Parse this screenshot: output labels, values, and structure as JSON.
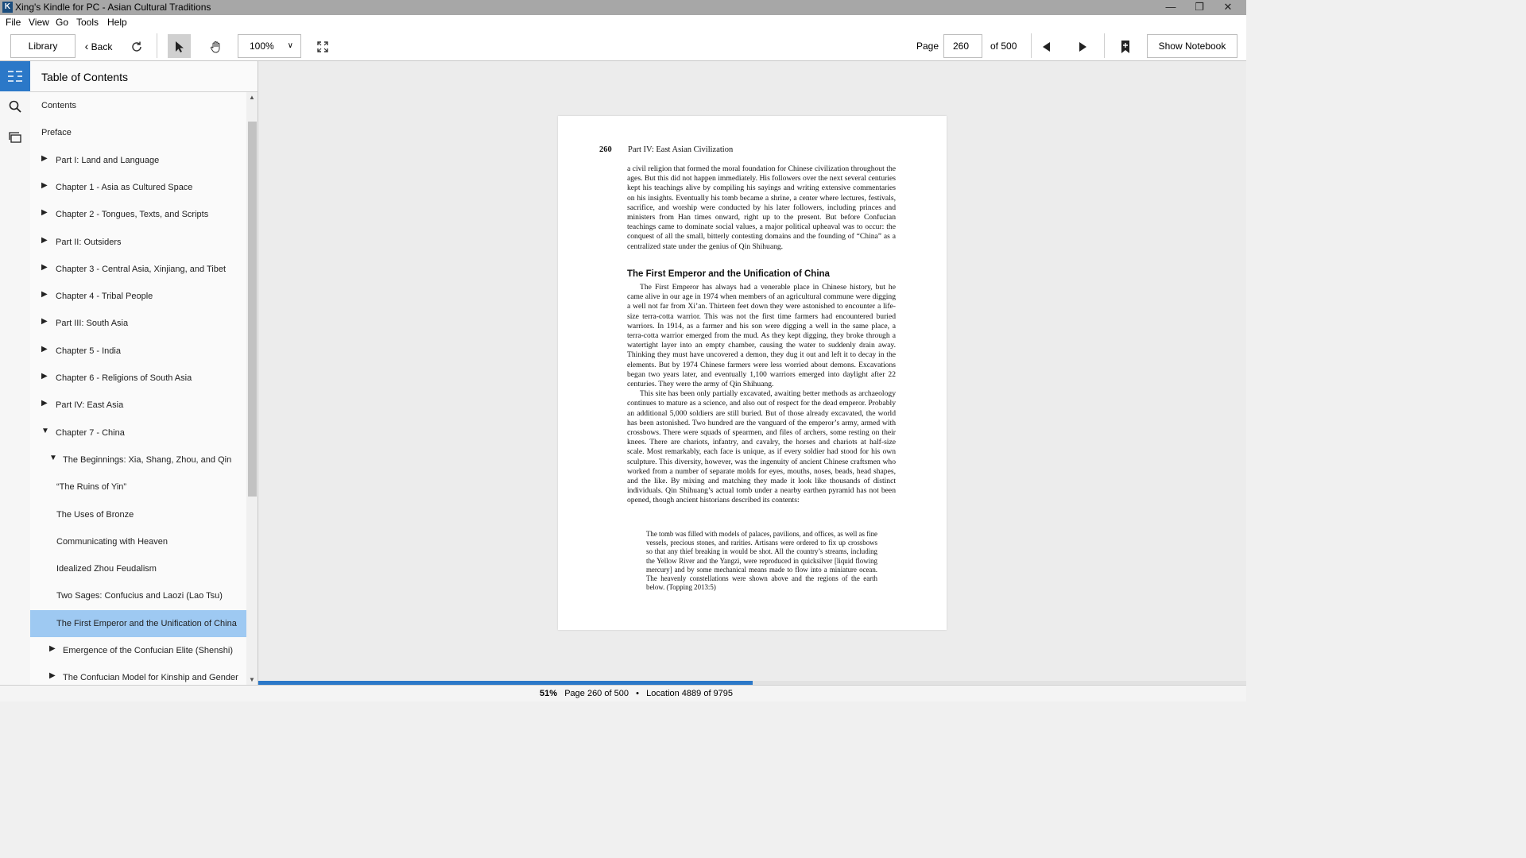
{
  "window": {
    "title": "Xing's Kindle for PC - Asian Cultural Traditions",
    "controls": [
      "minimize",
      "maximize",
      "close"
    ]
  },
  "menu": [
    "File",
    "View",
    "Go",
    "Tools",
    "Help"
  ],
  "toolbar": {
    "library_label": "Library",
    "back_label": "Back",
    "zoom_value": "100%",
    "page_label": "Page",
    "page_value": "260",
    "page_total": "of 500",
    "show_notebook_label": "Show Notebook"
  },
  "toc": {
    "title": "Table of Contents",
    "items": [
      {
        "label": "Contents",
        "level": 0,
        "arrow": "none"
      },
      {
        "label": "Preface",
        "level": 0,
        "arrow": "none"
      },
      {
        "label": "Part I: Land and Language",
        "level": 0,
        "arrow": "collapsed"
      },
      {
        "label": "Chapter 1 - Asia as Cultured Space",
        "level": 0,
        "arrow": "collapsed"
      },
      {
        "label": "Chapter 2 - Tongues, Texts, and Scripts",
        "level": 0,
        "arrow": "collapsed"
      },
      {
        "label": "Part II: Outsiders",
        "level": 0,
        "arrow": "collapsed"
      },
      {
        "label": "Chapter 3 - Central Asia, Xinjiang, and Tibet",
        "level": 0,
        "arrow": "collapsed"
      },
      {
        "label": "Chapter 4 - Tribal People",
        "level": 0,
        "arrow": "collapsed"
      },
      {
        "label": "Part III: South Asia",
        "level": 0,
        "arrow": "collapsed"
      },
      {
        "label": "Chapter 5 - India",
        "level": 0,
        "arrow": "collapsed"
      },
      {
        "label": "Chapter 6 - Religions of South Asia",
        "level": 0,
        "arrow": "collapsed"
      },
      {
        "label": "Part IV: East Asia",
        "level": 0,
        "arrow": "collapsed"
      },
      {
        "label": "Chapter 7 - China",
        "level": 0,
        "arrow": "expanded"
      },
      {
        "label": "The Beginnings: Xia, Shang, Zhou, and Qin",
        "level": 1,
        "arrow": "expanded"
      },
      {
        "label": "“The Ruins of Yin”",
        "level": 2,
        "arrow": "none"
      },
      {
        "label": "The Uses of Bronze",
        "level": 2,
        "arrow": "none"
      },
      {
        "label": "Communicating with Heaven",
        "level": 2,
        "arrow": "none"
      },
      {
        "label": "Idealized Zhou Feudalism",
        "level": 2,
        "arrow": "none"
      },
      {
        "label": "Two Sages: Confucius and Laozi (Lao Tsu)",
        "level": 2,
        "arrow": "none"
      },
      {
        "label": "The First Emperor and the Unification of China",
        "level": 2,
        "arrow": "none",
        "selected": true
      },
      {
        "label": "Emergence of the Confucian Elite (Shenshi)",
        "level": 1,
        "arrow": "collapsed"
      },
      {
        "label": "The Confucian Model for Kinship and Gender",
        "level": 1,
        "arrow": "collapsed"
      }
    ]
  },
  "page": {
    "number": "260",
    "running_head": "Part IV: East Asian Civilization",
    "paragraph_1": "a civil religion that formed the moral foundation for Chinese civilization throughout the ages. But this did not happen immediately. His followers over the next several centuries kept his teachings alive by compiling his sayings and writing extensive commentaries on his insights. Eventually his tomb became a shrine, a center where lectures, festivals, sacrifice, and worship were conducted by his later followers, including princes and ministers from Han times onward, right up to the present. But before Confucian teachings came to dominate social values, a major political upheaval was to occur: the conquest of all the small, bitterly contesting domains and the founding of “China” as a centralized state under the genius of Qin Shihuang.",
    "section_heading": "The First Emperor and the Unification of China",
    "paragraph_2": "The First Emperor has always had a venerable place in Chinese history, but he came alive in our age in 1974 when members of an agricultural commune were digging a well not far from Xi’an. Thirteen feet down they were astonished to encounter a life-size terra-cotta warrior. This was not the first time farmers had encountered buried warriors. In 1914, as a farmer and his son were digging a well in the same place, a terra-cotta warrior emerged from the mud. As they kept digging, they broke through a watertight layer into an empty chamber, causing the water to suddenly drain away. Thinking they must have uncovered a demon, they dug it out and left it to decay in the elements. But by 1974 Chinese farmers were less worried about demons. Excavations began two years later, and eventually 1,100 warriors emerged into daylight after 22 centuries. They were the army of Qin Shihuang.",
    "paragraph_3": "This site has been only partially excavated, awaiting better methods as archaeology continues to mature as a science, and also out of respect for the dead emperor. Probably an additional 5,000 soldiers are still buried. But of those already excavated, the world has been astonished. Two hundred are the vanguard of the emperor’s army, armed with crossbows. There were squads of spearmen, and files of archers, some resting on their knees. There are chariots, infantry, and cavalry, the horses and chariots at half-size scale. Most remarkably, each face is unique, as if every soldier had stood for his own sculpture. This diversity, however, was the ingenuity of ancient Chinese craftsmen who worked from a number of separate molds for eyes, mouths, noses, beads, head shapes, and the like. By mixing and matching they made it look like thousands of distinct individuals. Qin Shihuang’s actual tomb under a nearby earthen pyramid has not been opened, though ancient historians described its contents:",
    "quote": "The tomb was filled with models of palaces, pavilions, and offices, as well as fine vessels, precious stones, and rarities. Artisans were ordered to fix up crossbows so that any thief breaking in would be shot. All the country’s streams, including the Yellow River and the Yangzi, were reproduced in quicksilver [liquid flowing mercury] and by some mechanical means made to flow into a miniature ocean. The heavenly constellations were shown above and the regions of the earth below. (Topping 2013:5)"
  },
  "status": {
    "percent": "51%",
    "page_info": "Page 260 of 500",
    "separator": "•",
    "location": "Location 4889 of 9795",
    "progress_fraction": 0.5
  },
  "colors": {
    "accent": "#2b78c8",
    "selected_row": "#9ec9f2",
    "titlebar": "#a7a7a7"
  }
}
